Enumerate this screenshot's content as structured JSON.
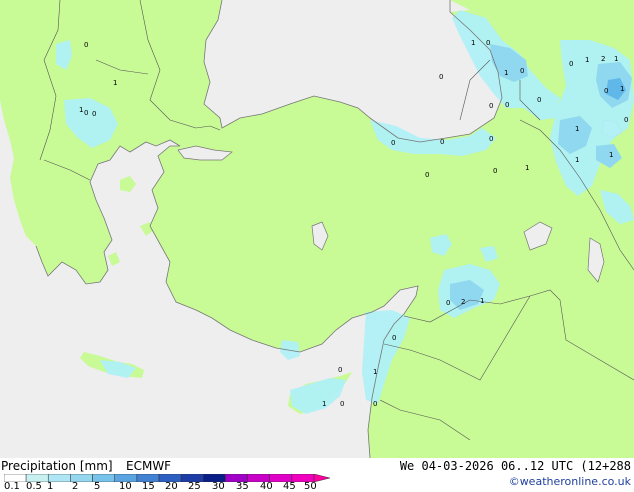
{
  "map": {
    "colors": {
      "sea": "#eeeeee",
      "land_no_rain": "#c8fa96",
      "coast": "#777777",
      "border": "#555555",
      "precip_light": "#aff0f5",
      "precip_medium": "#8fd8ef",
      "precip_heavy": "#5fb8e8"
    },
    "contour_labels": [
      "0",
      "1",
      "1",
      "0",
      "0",
      "1",
      "0",
      "1",
      "0",
      "0",
      "0",
      "1",
      "2",
      "1",
      "1",
      "0",
      "1",
      "0",
      "0",
      "1",
      "1",
      "0",
      "0",
      "0",
      "0",
      "0",
      "2",
      "1",
      "0",
      "0",
      "1",
      "0",
      "1",
      "0",
      "1",
      "0",
      "0",
      "0"
    ]
  },
  "legend": {
    "title": "Precipitation [mm]",
    "model": "ECMWF",
    "valid_time": "We 04-03-2026 06..12 UTC (12+288",
    "credit": "©weatheronline.co.uk",
    "scale_ticks": [
      "0.1",
      "0.5",
      "1",
      "2",
      "5",
      "10",
      "15",
      "20",
      "25",
      "30",
      "35",
      "40",
      "45",
      "50"
    ],
    "scale_colors": [
      "#ffffff",
      "#c8f0f0",
      "#afe6f5",
      "#96d7f0",
      "#78c3eb",
      "#5aa5e1",
      "#4182d2",
      "#2d5fc3",
      "#1e3ca5",
      "#0a1e87",
      "#a000c8",
      "#c800c8",
      "#e100c8",
      "#f000be",
      "#ff00a0"
    ]
  }
}
